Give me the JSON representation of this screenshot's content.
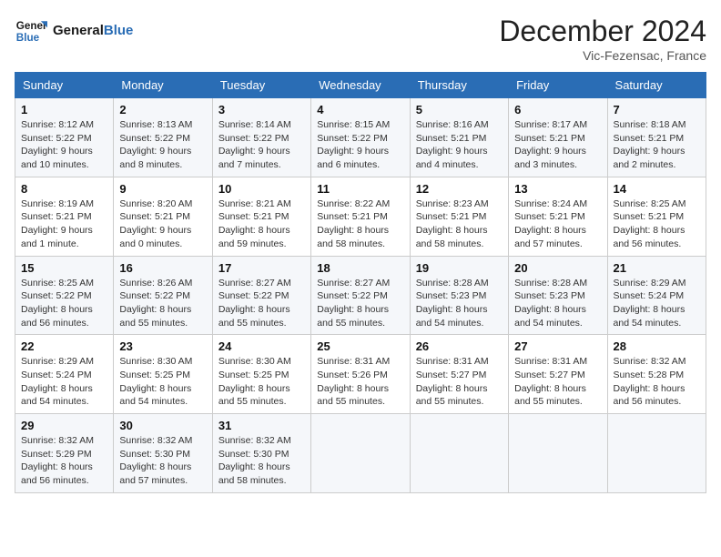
{
  "header": {
    "logo_line1": "General",
    "logo_line2": "Blue",
    "month_title": "December 2024",
    "location": "Vic-Fezensac, France"
  },
  "weekdays": [
    "Sunday",
    "Monday",
    "Tuesday",
    "Wednesday",
    "Thursday",
    "Friday",
    "Saturday"
  ],
  "weeks": [
    [
      {
        "day": "1",
        "info": "Sunrise: 8:12 AM\nSunset: 5:22 PM\nDaylight: 9 hours\nand 10 minutes."
      },
      {
        "day": "2",
        "info": "Sunrise: 8:13 AM\nSunset: 5:22 PM\nDaylight: 9 hours\nand 8 minutes."
      },
      {
        "day": "3",
        "info": "Sunrise: 8:14 AM\nSunset: 5:22 PM\nDaylight: 9 hours\nand 7 minutes."
      },
      {
        "day": "4",
        "info": "Sunrise: 8:15 AM\nSunset: 5:22 PM\nDaylight: 9 hours\nand 6 minutes."
      },
      {
        "day": "5",
        "info": "Sunrise: 8:16 AM\nSunset: 5:21 PM\nDaylight: 9 hours\nand 4 minutes."
      },
      {
        "day": "6",
        "info": "Sunrise: 8:17 AM\nSunset: 5:21 PM\nDaylight: 9 hours\nand 3 minutes."
      },
      {
        "day": "7",
        "info": "Sunrise: 8:18 AM\nSunset: 5:21 PM\nDaylight: 9 hours\nand 2 minutes."
      }
    ],
    [
      {
        "day": "8",
        "info": "Sunrise: 8:19 AM\nSunset: 5:21 PM\nDaylight: 9 hours\nand 1 minute."
      },
      {
        "day": "9",
        "info": "Sunrise: 8:20 AM\nSunset: 5:21 PM\nDaylight: 9 hours\nand 0 minutes."
      },
      {
        "day": "10",
        "info": "Sunrise: 8:21 AM\nSunset: 5:21 PM\nDaylight: 8 hours\nand 59 minutes."
      },
      {
        "day": "11",
        "info": "Sunrise: 8:22 AM\nSunset: 5:21 PM\nDaylight: 8 hours\nand 58 minutes."
      },
      {
        "day": "12",
        "info": "Sunrise: 8:23 AM\nSunset: 5:21 PM\nDaylight: 8 hours\nand 58 minutes."
      },
      {
        "day": "13",
        "info": "Sunrise: 8:24 AM\nSunset: 5:21 PM\nDaylight: 8 hours\nand 57 minutes."
      },
      {
        "day": "14",
        "info": "Sunrise: 8:25 AM\nSunset: 5:21 PM\nDaylight: 8 hours\nand 56 minutes."
      }
    ],
    [
      {
        "day": "15",
        "info": "Sunrise: 8:25 AM\nSunset: 5:22 PM\nDaylight: 8 hours\nand 56 minutes."
      },
      {
        "day": "16",
        "info": "Sunrise: 8:26 AM\nSunset: 5:22 PM\nDaylight: 8 hours\nand 55 minutes."
      },
      {
        "day": "17",
        "info": "Sunrise: 8:27 AM\nSunset: 5:22 PM\nDaylight: 8 hours\nand 55 minutes."
      },
      {
        "day": "18",
        "info": "Sunrise: 8:27 AM\nSunset: 5:22 PM\nDaylight: 8 hours\nand 55 minutes."
      },
      {
        "day": "19",
        "info": "Sunrise: 8:28 AM\nSunset: 5:23 PM\nDaylight: 8 hours\nand 54 minutes."
      },
      {
        "day": "20",
        "info": "Sunrise: 8:28 AM\nSunset: 5:23 PM\nDaylight: 8 hours\nand 54 minutes."
      },
      {
        "day": "21",
        "info": "Sunrise: 8:29 AM\nSunset: 5:24 PM\nDaylight: 8 hours\nand 54 minutes."
      }
    ],
    [
      {
        "day": "22",
        "info": "Sunrise: 8:29 AM\nSunset: 5:24 PM\nDaylight: 8 hours\nand 54 minutes."
      },
      {
        "day": "23",
        "info": "Sunrise: 8:30 AM\nSunset: 5:25 PM\nDaylight: 8 hours\nand 54 minutes."
      },
      {
        "day": "24",
        "info": "Sunrise: 8:30 AM\nSunset: 5:25 PM\nDaylight: 8 hours\nand 55 minutes."
      },
      {
        "day": "25",
        "info": "Sunrise: 8:31 AM\nSunset: 5:26 PM\nDaylight: 8 hours\nand 55 minutes."
      },
      {
        "day": "26",
        "info": "Sunrise: 8:31 AM\nSunset: 5:27 PM\nDaylight: 8 hours\nand 55 minutes."
      },
      {
        "day": "27",
        "info": "Sunrise: 8:31 AM\nSunset: 5:27 PM\nDaylight: 8 hours\nand 55 minutes."
      },
      {
        "day": "28",
        "info": "Sunrise: 8:32 AM\nSunset: 5:28 PM\nDaylight: 8 hours\nand 56 minutes."
      }
    ],
    [
      {
        "day": "29",
        "info": "Sunrise: 8:32 AM\nSunset: 5:29 PM\nDaylight: 8 hours\nand 56 minutes."
      },
      {
        "day": "30",
        "info": "Sunrise: 8:32 AM\nSunset: 5:30 PM\nDaylight: 8 hours\nand 57 minutes."
      },
      {
        "day": "31",
        "info": "Sunrise: 8:32 AM\nSunset: 5:30 PM\nDaylight: 8 hours\nand 58 minutes."
      },
      {
        "day": "",
        "info": ""
      },
      {
        "day": "",
        "info": ""
      },
      {
        "day": "",
        "info": ""
      },
      {
        "day": "",
        "info": ""
      }
    ]
  ]
}
